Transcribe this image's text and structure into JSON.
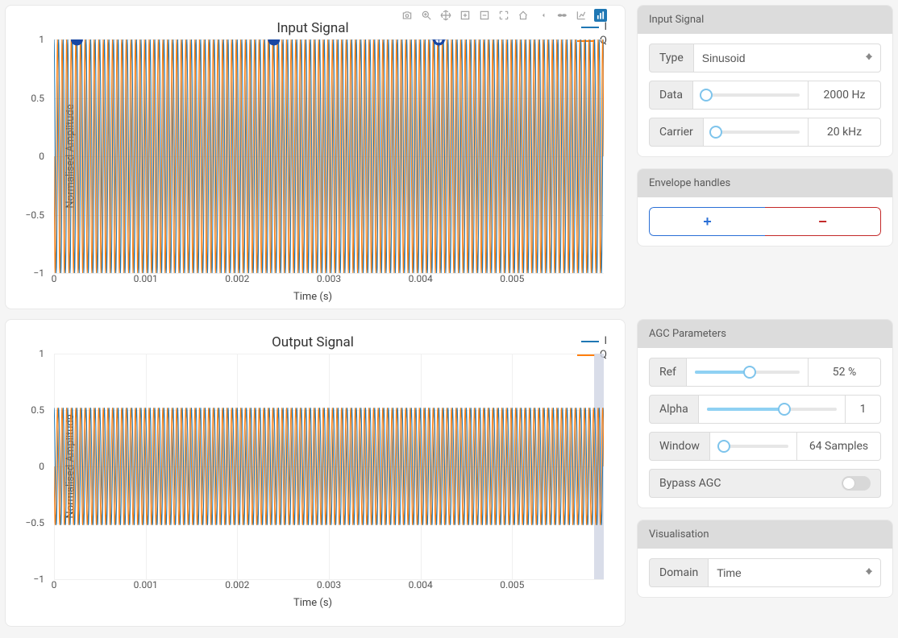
{
  "panels": {
    "input": {
      "title": "Input Signal",
      "xlabel": "Time (s)",
      "ylabel": "Normalised Amplitude",
      "legend": [
        {
          "name": "I",
          "color": "#1f77b4"
        },
        {
          "name": "Q",
          "color": "#ff7f0e"
        }
      ],
      "xticks": [
        "0",
        "0.001",
        "0.002",
        "0.003",
        "0.004",
        "0.005"
      ],
      "yticks": [
        "1",
        "0.5",
        "0",
        "−0.5",
        "−1"
      ],
      "envelope_handles": [
        {
          "t": 0.00025,
          "a": 1.0,
          "active": false
        },
        {
          "t": 0.0024,
          "a": 1.0,
          "active": false
        },
        {
          "t": 0.0042,
          "a": 1.0,
          "active": true
        }
      ]
    },
    "output": {
      "title": "Output Signal",
      "xlabel": "Time (s)",
      "ylabel": "Normalised Amplitude",
      "legend": [
        {
          "name": "I",
          "color": "#1f77b4"
        },
        {
          "name": "Q",
          "color": "#ff7f0e"
        }
      ],
      "xticks": [
        "0",
        "0.001",
        "0.002",
        "0.003",
        "0.004",
        "0.005"
      ],
      "yticks": [
        "1",
        "0.5",
        "0",
        "−0.5",
        "−1"
      ]
    }
  },
  "controls": {
    "input_signal": {
      "header": "Input Signal",
      "type_label": "Type",
      "type_value": "Sinusoid",
      "data_label": "Data",
      "data_value": "2000 Hz",
      "data_pct": 5,
      "carrier_label": "Carrier",
      "carrier_value": "20 kHz",
      "carrier_pct": 5
    },
    "envelope": {
      "header": "Envelope handles",
      "add_label": "+",
      "remove_label": "−"
    },
    "agc": {
      "header": "AGC Parameters",
      "ref_label": "Ref",
      "ref_value": "52 %",
      "ref_pct": 52,
      "alpha_label": "Alpha",
      "alpha_value": "1",
      "alpha_pct": 60,
      "window_label": "Window",
      "window_value": "64 Samples",
      "window_pct": 8,
      "bypass_label": "Bypass AGC",
      "bypass_on": false
    },
    "visualisation": {
      "header": "Visualisation",
      "domain_label": "Domain",
      "domain_value": "Time"
    }
  },
  "chart_data": [
    {
      "type": "line",
      "title": "Input Signal",
      "xlabel": "Time (s)",
      "ylabel": "Normalised Amplitude",
      "xlim": [
        0,
        0.006
      ],
      "ylim": [
        -1,
        1
      ],
      "carrier_hz": 20000,
      "amplitude": 1.0,
      "series": [
        {
          "name": "I",
          "phase_deg": 0,
          "color": "#1f77b4"
        },
        {
          "name": "Q",
          "phase_deg": 90,
          "color": "#ff7f0e"
        }
      ],
      "envelope_handles": [
        {
          "t": 0.00025,
          "a": 1.0
        },
        {
          "t": 0.0024,
          "a": 1.0
        },
        {
          "t": 0.0042,
          "a": 1.0
        }
      ]
    },
    {
      "type": "line",
      "title": "Output Signal",
      "xlabel": "Time (s)",
      "ylabel": "Normalised Amplitude",
      "xlim": [
        0,
        0.006
      ],
      "ylim": [
        -1,
        1
      ],
      "carrier_hz": 20000,
      "amplitude": 0.52,
      "series": [
        {
          "name": "I",
          "phase_deg": 0,
          "color": "#1f77b4"
        },
        {
          "name": "Q",
          "phase_deg": 90,
          "color": "#ff7f0e"
        }
      ]
    }
  ],
  "modebar_icons": [
    "camera",
    "zoom",
    "pan",
    "zoom-in",
    "zoom-out",
    "autoscale",
    "reset",
    "hover-closest",
    "hover-compare",
    "toggle-spike",
    "plotly-logo"
  ]
}
